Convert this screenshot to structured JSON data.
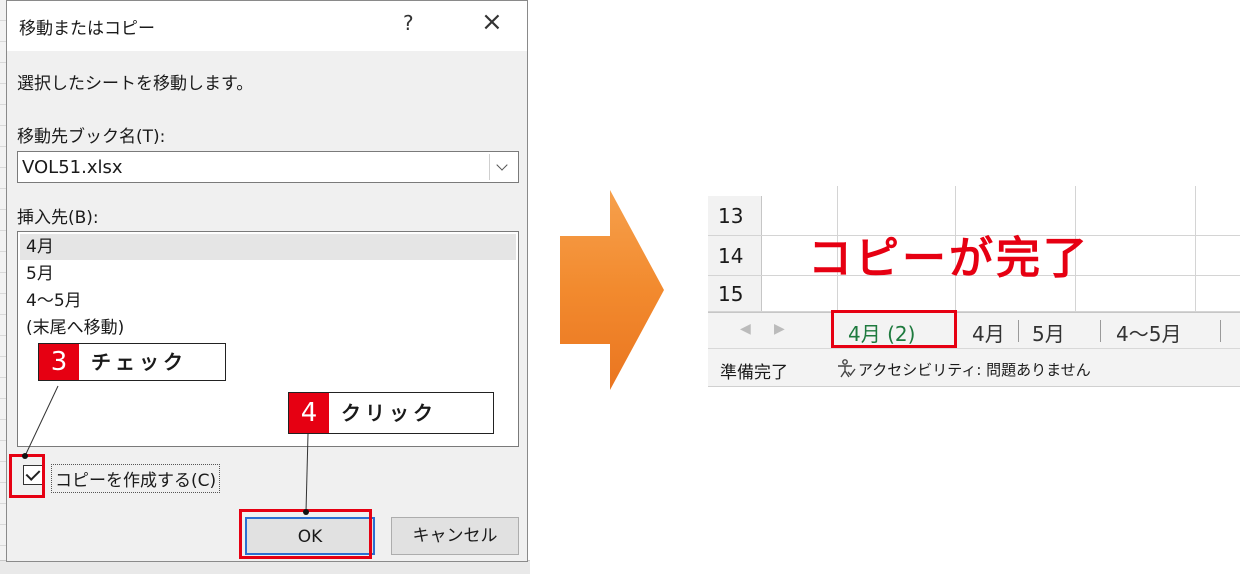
{
  "dialog": {
    "title": "移動またはコピー",
    "help": "?",
    "close": "×",
    "instruction": "選択したシートを移動します。",
    "book_label": "移動先ブック名(T):",
    "book_value": "VOL51.xlsx",
    "insert_label": "挿入先(B):",
    "sheets": [
      "4月",
      "5月",
      "4～5月",
      "(末尾へ移動)"
    ],
    "copy_label": "コピーを作成する(C)",
    "ok_label": "OK",
    "cancel_label": "キャンセル"
  },
  "callouts": {
    "step3": {
      "num": "3",
      "text": "チェック"
    },
    "step4": {
      "num": "4",
      "text": "クリック"
    }
  },
  "excel": {
    "rows": [
      "13",
      "14",
      "15"
    ],
    "tabs": [
      "4月 (2)",
      "4月",
      "5月",
      "4～5月"
    ],
    "status_ready": "準備完了",
    "status_accessibility": "アクセシビリティ: 問題ありません"
  },
  "annotation": {
    "complete": "コピーが完了"
  },
  "colors": {
    "accent_red": "#e60012",
    "arrow_orange": "#f28a2e",
    "active_tab_green": "#1e7a3e"
  }
}
